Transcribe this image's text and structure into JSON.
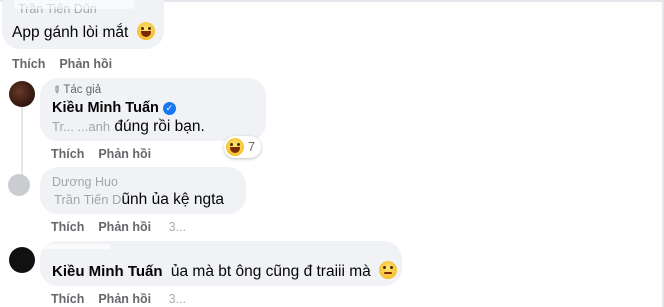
{
  "comments": [
    {
      "name_faded": "Trần Tiến Dũn",
      "text": "App gánh lòi mắt",
      "actions": {
        "like": "Thích",
        "reply": "Phản hồi"
      }
    },
    {
      "author_tag": "Tác giả",
      "name": "Kiều Minh Tuấn",
      "text_faded": "Tr... ...anh",
      "text": "đúng rồi bạn.",
      "actions": {
        "like": "Thích",
        "reply": "Phản hồi"
      },
      "reaction_count": "7"
    },
    {
      "name_faded": "Dương Huo",
      "text_faded": "Trần Tiến D",
      "text": "ũnh ủa kệ ngta",
      "actions": {
        "like": "Thích",
        "reply": "Phản hồi"
      },
      "timestamp_faded": "3..."
    },
    {
      "name": "Kiều Minh Tuấn",
      "text": "ủa mà bt ông cũng đ traiii mà",
      "actions": {
        "like": "Thích",
        "reply": "Phản hồi"
      },
      "timestamp_faded": "3..."
    }
  ],
  "colors": {
    "bubble": "#f0f2f5",
    "text": "#050505",
    "muted": "#65676b",
    "verified": "#1877f2"
  }
}
